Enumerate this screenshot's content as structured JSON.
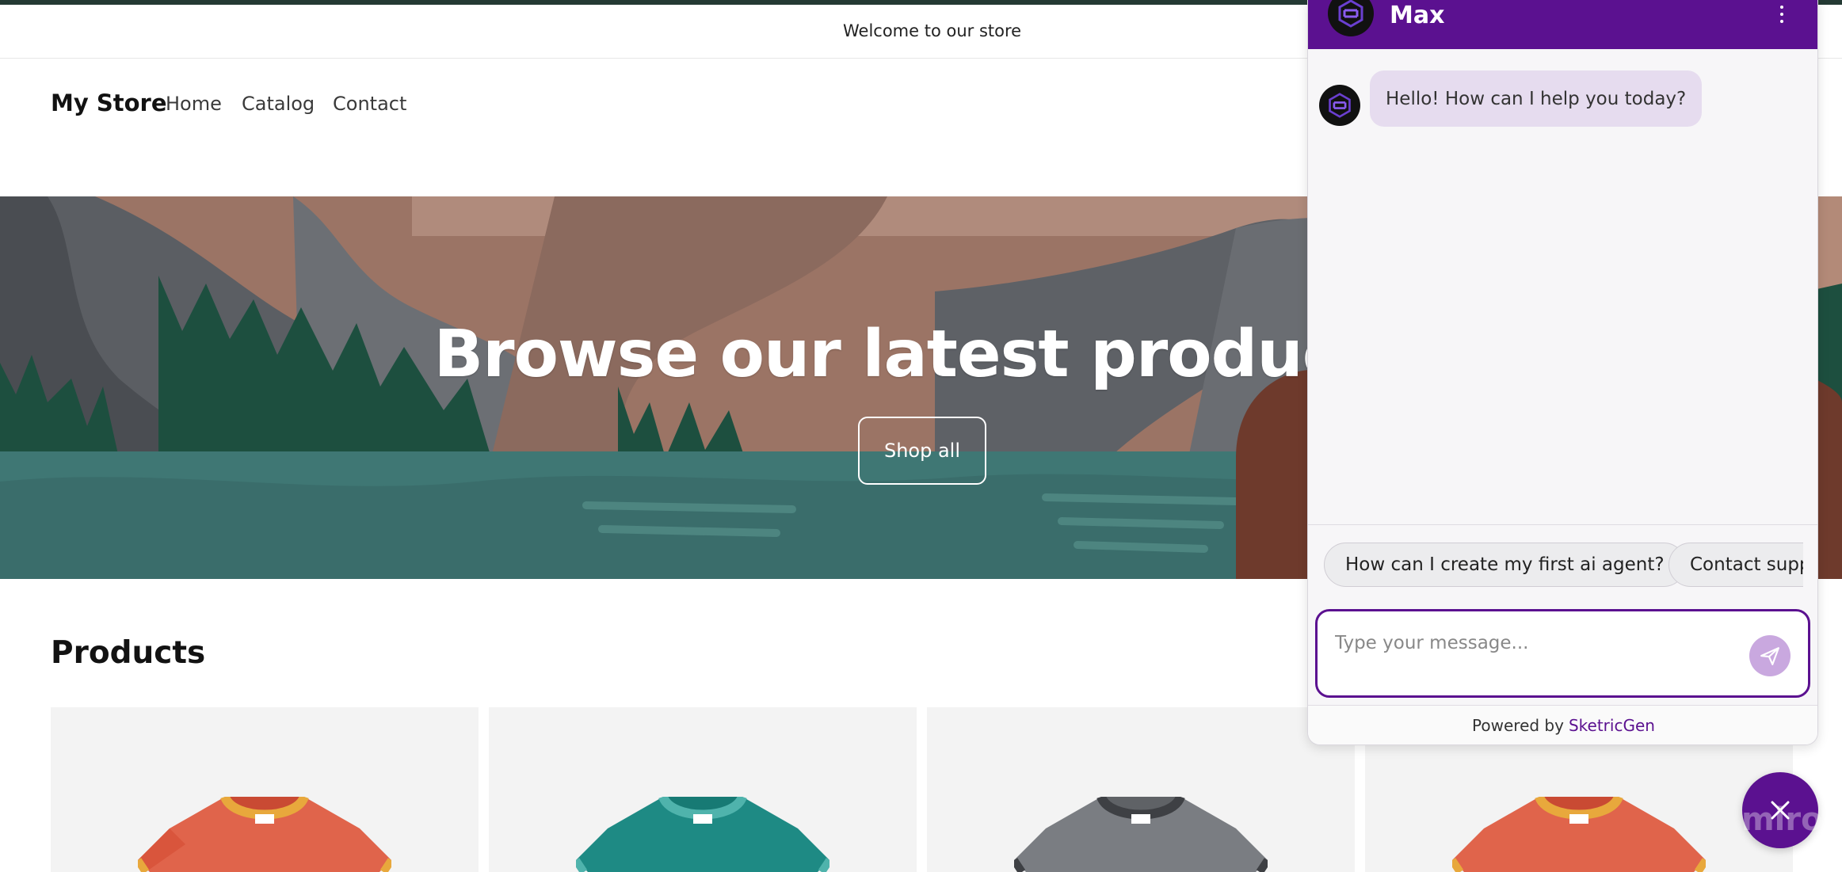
{
  "announcement": {
    "text": "Welcome to our store"
  },
  "header": {
    "logo": "My Store",
    "nav": [
      {
        "label": "Home"
      },
      {
        "label": "Catalog"
      },
      {
        "label": "Contact"
      }
    ]
  },
  "hero": {
    "title": "Browse our latest products",
    "button": "Shop all"
  },
  "products": {
    "title": "Products",
    "items": [
      {
        "icon": "tshirt-orange-icon",
        "color": "#e0644b"
      },
      {
        "icon": "tshirt-teal-icon",
        "color": "#1e8a84"
      },
      {
        "icon": "tshirt-gray-icon",
        "color": "#7a7d82"
      },
      {
        "icon": "tshirt-orange-icon",
        "color": "#e0644b"
      }
    ]
  },
  "chat": {
    "agent_name": "Max",
    "greeting": "Hello! How can I help you today?",
    "suggestions": [
      {
        "label": "How can I create my first ai agent?"
      },
      {
        "label": "Contact supp"
      }
    ],
    "input_placeholder": "Type your message...",
    "powered_by_prefix": "Powered by",
    "powered_by_brand": "SketricGen",
    "accent_color": "#5b1190"
  },
  "watermark": "miro"
}
